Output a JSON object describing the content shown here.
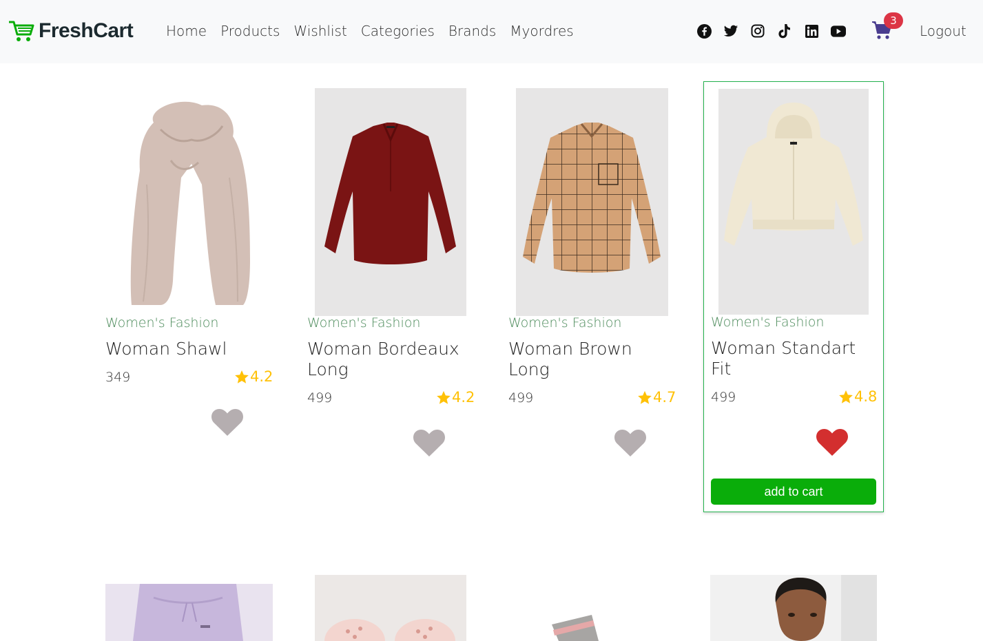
{
  "brand": {
    "name": "FreshCart"
  },
  "nav": {
    "links": [
      "Home",
      "Products",
      "Wishlist",
      "Categories",
      "Brands",
      "Myordres"
    ]
  },
  "socials": [
    "facebook-icon",
    "twitter-icon",
    "instagram-icon",
    "tiktok-icon",
    "linkedin-icon",
    "youtube-icon"
  ],
  "cart": {
    "count": "3"
  },
  "logout": "Logout",
  "colors": {
    "accent": "#0aad0a",
    "category": "#4b8a5a",
    "star": "#ffc107",
    "heart_active": "#d32f2f",
    "heart_inactive": "#b5aeb0",
    "badge": "#dc3545"
  },
  "products": [
    {
      "category": "Women's Fashion",
      "title": "Woman Shawl",
      "price": "349",
      "rating": "4.2",
      "wishlisted": false
    },
    {
      "category": "Women's Fashion",
      "title": "Woman Bordeaux Long",
      "price": "499",
      "rating": "4.2",
      "wishlisted": false
    },
    {
      "category": "Women's Fashion",
      "title": "Woman Brown Long",
      "price": "499",
      "rating": "4.7",
      "wishlisted": false
    },
    {
      "category": "Women's Fashion",
      "title": "Woman Standart Fit",
      "price": "499",
      "rating": "4.8",
      "wishlisted": true,
      "add_to_cart": "add to cart"
    }
  ]
}
